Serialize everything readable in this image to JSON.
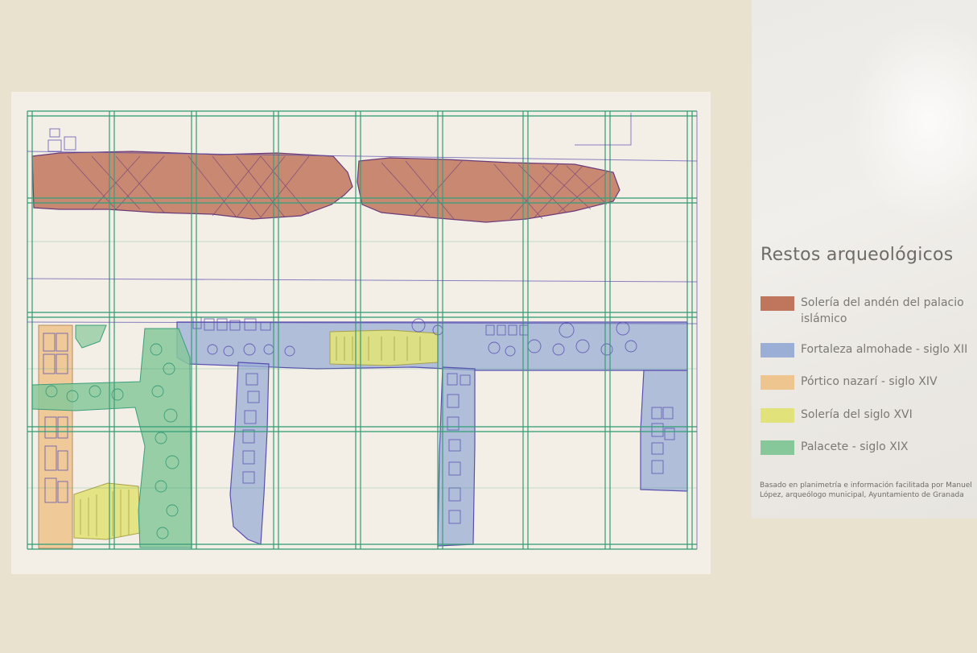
{
  "colors": {
    "background": "#e9e2cf",
    "plan_paper": "#f4efe6",
    "grid": "#3b9e7a",
    "outline": "#5a4fb0"
  },
  "legend": {
    "title": "Restos arqueológicos",
    "items": [
      {
        "label": "Solería del andén del palacio islámico",
        "color": "#c0765d",
        "icon": "swatch-red"
      },
      {
        "label": "Fortaleza almohade - siglo XII",
        "color": "#9aaed6",
        "icon": "swatch-blue"
      },
      {
        "label": "Pórtico nazarí - siglo XIV",
        "color": "#eec58f",
        "icon": "swatch-orange"
      },
      {
        "label": "Solería del siglo XVI",
        "color": "#e2e27a",
        "icon": "swatch-yellow"
      },
      {
        "label": "Palacete - siglo XIX",
        "color": "#86c89a",
        "icon": "swatch-green"
      }
    ],
    "credit": "Basado en planimetría e información facilitada por Manuel López, arqueólogo municipal, Ayuntamiento de Granada"
  }
}
